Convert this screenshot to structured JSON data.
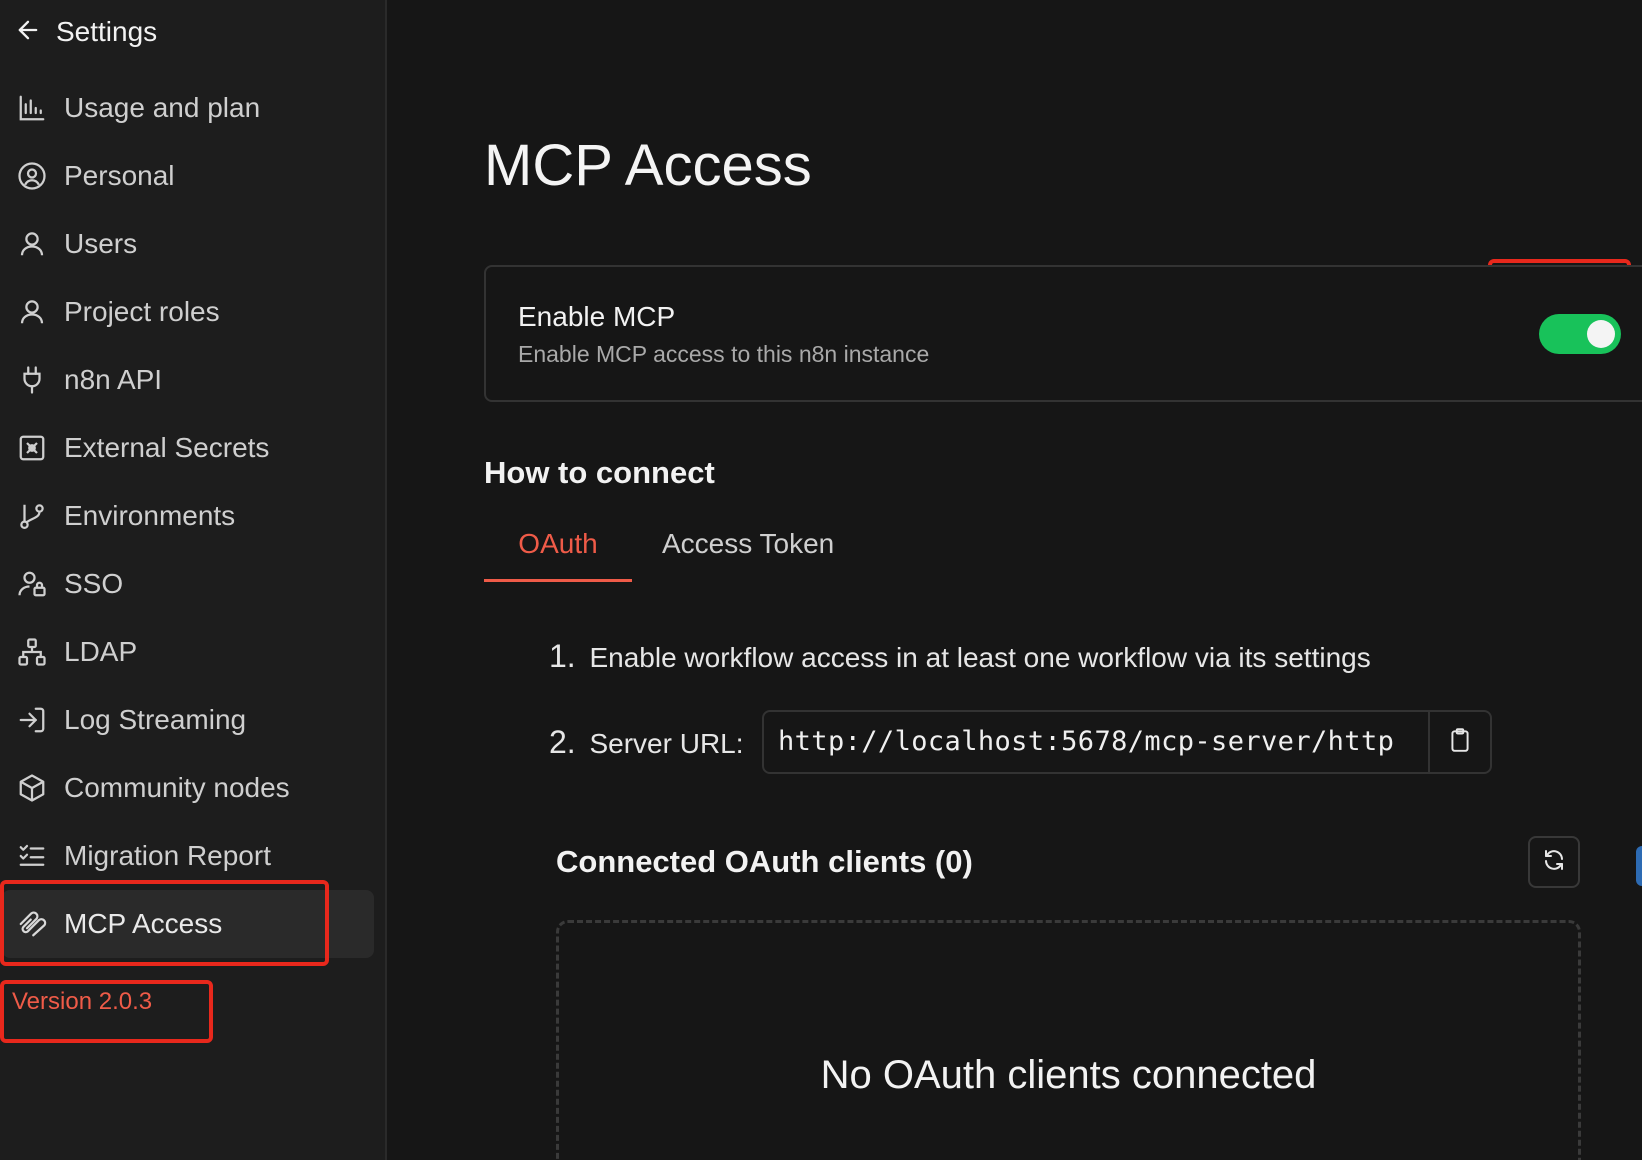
{
  "sidebar": {
    "back_label": "Settings",
    "items": [
      {
        "label": "Usage and plan",
        "icon": "bar-chart-icon"
      },
      {
        "label": "Personal",
        "icon": "user-circle-icon"
      },
      {
        "label": "Users",
        "icon": "user-icon"
      },
      {
        "label": "Project roles",
        "icon": "user-icon"
      },
      {
        "label": "n8n API",
        "icon": "plug-icon"
      },
      {
        "label": "External Secrets",
        "icon": "vault-icon"
      },
      {
        "label": "Environments",
        "icon": "git-branch-icon"
      },
      {
        "label": "SSO",
        "icon": "user-lock-icon"
      },
      {
        "label": "LDAP",
        "icon": "network-icon"
      },
      {
        "label": "Log Streaming",
        "icon": "log-in-icon"
      },
      {
        "label": "Community nodes",
        "icon": "box-icon"
      },
      {
        "label": "Migration Report",
        "icon": "list-checks-icon"
      },
      {
        "label": "MCP Access",
        "icon": "mcp-icon",
        "active": true
      }
    ],
    "version": "Version 2.0.3"
  },
  "main": {
    "title": "MCP Access",
    "enable_card": {
      "title": "Enable MCP",
      "subtitle": "Enable MCP access to this n8n instance",
      "enabled": true
    },
    "how_to_connect": {
      "title": "How to connect",
      "tabs": [
        {
          "label": "OAuth",
          "active": true
        },
        {
          "label": "Access Token",
          "active": false
        }
      ],
      "step1_num": "1.",
      "step1_text": "Enable workflow access in at least one workflow via its settings",
      "step2_num": "2.",
      "step2_label": "Server URL:",
      "server_url": "http://localhost:5678/mcp-server/http"
    },
    "clients": {
      "title": "Connected OAuth clients (0)",
      "empty_text": "No OAuth clients connected"
    }
  },
  "colors": {
    "accent": "#ef5b48",
    "toggle_on": "#18c25a",
    "highlight": "#e8281c",
    "background": "#161616",
    "sidebar_bg": "#1d1d1d"
  }
}
